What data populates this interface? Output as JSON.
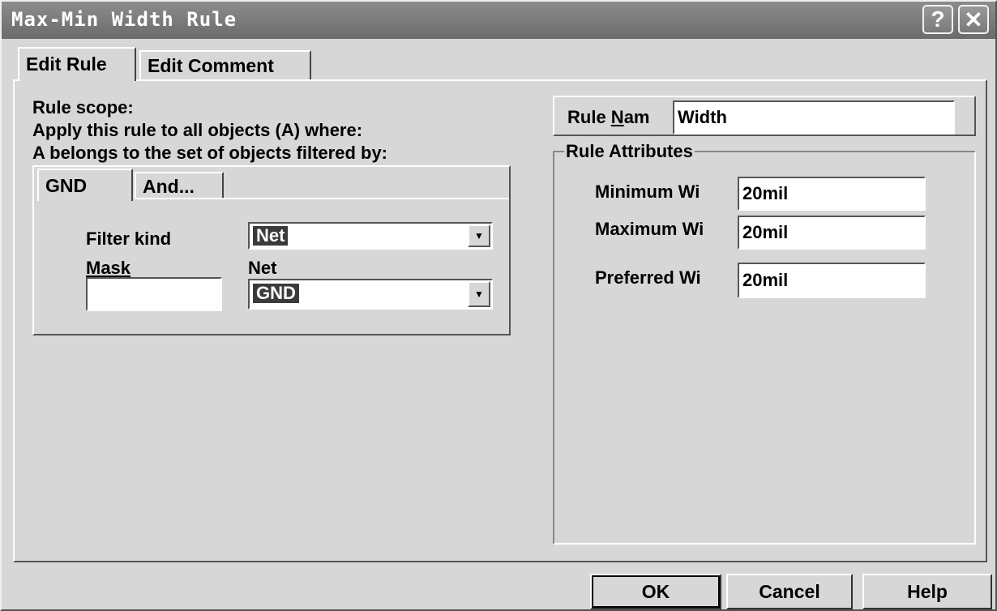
{
  "window": {
    "title": "Max-Min Width Rule"
  },
  "titlebar": {
    "help_glyph": "?",
    "close_glyph": "✕"
  },
  "tabs": [
    {
      "label": "Edit Rule"
    },
    {
      "label": "Edit Comment"
    }
  ],
  "scope": {
    "line1": "Rule scope:",
    "line2": "Apply this rule to all objects (A) where:",
    "line3": "A belongs to the set of objects filtered by:"
  },
  "filter_tabs": [
    {
      "label": "GND"
    },
    {
      "label": "And..."
    }
  ],
  "filter": {
    "kind_label": "Filter kind",
    "kind_value": "Net",
    "mask_label": "Mask",
    "mask_value": "",
    "net_label": "Net",
    "net_value": "GND"
  },
  "rule_name": {
    "label_prefix": "Rule ",
    "label_underlined": "N",
    "label_suffix": "am",
    "value": "Width"
  },
  "attributes": {
    "group_label": "Rule Attributes",
    "minimum_label": "Minimum Wi",
    "minimum_value": "20mil",
    "maximum_label": "Maximum Wi",
    "maximum_value": "20mil",
    "preferred_label": "Preferred Wi",
    "preferred_value": "20mil"
  },
  "buttons": {
    "ok": "OK",
    "cancel": "Cancel",
    "help": "Help"
  }
}
